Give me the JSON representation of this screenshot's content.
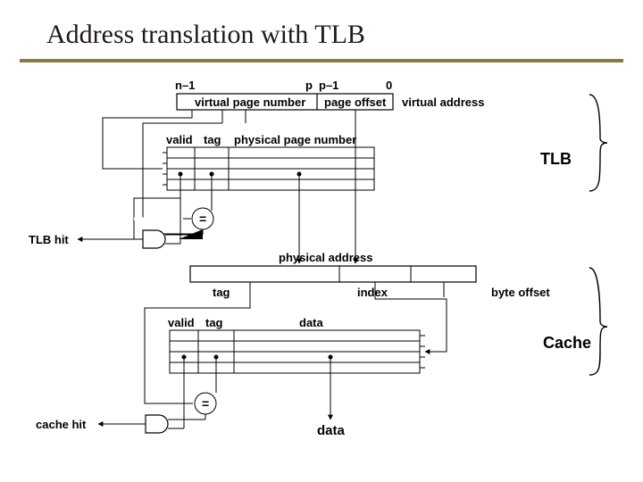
{
  "title": "Address translation with TLB",
  "virtual_address": {
    "bit_n1": "n–1",
    "bit_p": "p",
    "bit_p1": "p–1",
    "bit_0": "0",
    "vpn_label": "virtual page number",
    "po_label": "page offset",
    "side_label": "virtual address"
  },
  "tlb": {
    "col_valid": "valid",
    "col_tag": "tag",
    "col_ppn": "physical page number",
    "side_label": "TLB",
    "hit_label": "TLB hit",
    "eq": "="
  },
  "physaddr": {
    "label": "physical address",
    "tag": "tag",
    "index": "index",
    "byte_offset": "byte offset"
  },
  "cache": {
    "col_valid": "valid",
    "col_tag": "tag",
    "col_data": "data",
    "side_label": "Cache",
    "hit_label": "cache hit",
    "eq": "=",
    "data_out": "data"
  }
}
